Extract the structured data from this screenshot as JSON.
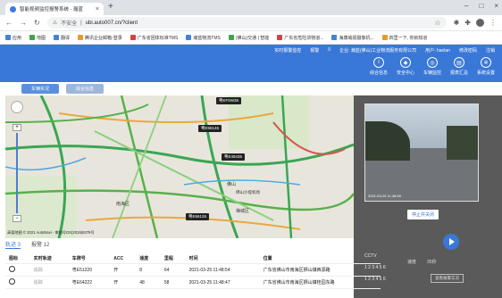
{
  "browser": {
    "tab_title": "智能视频监控报警系统 - 瀚蓝",
    "url_warning": "不安全",
    "url": "ubi.auto007.cn/?client",
    "bookmarks": [
      "应用",
      "地图",
      "翻译",
      "腾讯企业邮箱-登录",
      "广东省团体标准TMS",
      "瀚蓝物流TMS",
      "(佛山)交通 | 智能",
      "广东省危险货物道...",
      "海康威视摄像机...",
      "四里一下, 你就知道"
    ]
  },
  "header": {
    "user_items": [
      "实时报警监控",
      "报警",
      "0",
      "企业: 瀚蓝(佛山)工业物流服务有限公司",
      "用户: hanlan",
      "修改密码",
      "注销"
    ],
    "nav": [
      "综合信息",
      "安全中心",
      "车辆监控",
      "报表汇总",
      "系统设置"
    ],
    "nav_icons": [
      "info-icon",
      "shield-icon",
      "monitor-icon",
      "report-icon",
      "gear-icon"
    ]
  },
  "toolbar": {
    "realtime": "车辆实况",
    "overview": "综合信息"
  },
  "map": {
    "vehicles": [
      "粤EF5W36",
      "粤E56146",
      "粤E49435",
      "粤E66126"
    ],
    "cities": [
      "南海区",
      "佛山",
      "禅城区",
      "佛山沙堤机场"
    ],
    "attribution": "高德地图 © 2021 AutoNavi - 审图号GS(2019)6379号"
  },
  "video": {
    "timestamp": "2021-03-25 11:48:58",
    "stop_label": "停止并关闭",
    "speed_label": "速度",
    "speed_value": "35秒",
    "alarm_btn": "查看报警实况"
  },
  "panel": {
    "tabs": [
      "轨迹 3",
      "报警 12"
    ],
    "headers": [
      "图标",
      "实时轨迹",
      "车牌号",
      "ACC",
      "速度",
      "里程",
      "时间",
      "位置"
    ],
    "rows": [
      {
        "track": "追踪",
        "plate": "粤E51220",
        "acc": "开",
        "speed": "8",
        "mileage": "64",
        "time": "2021-03-25 11:48:54",
        "location": "广东省佛山市南海区狮山镇西源路"
      },
      {
        "track": "追踪",
        "plate": "粤E64222",
        "acc": "开",
        "speed": "48",
        "mileage": "58",
        "time": "2021-03-25 11:48:47",
        "location": "广东省佛山市南海区狮山镇桂园东路"
      }
    ],
    "cctv_header": "CCTV",
    "cctv_values": [
      "1 2 3 4 5 6",
      "1 2 3 4 5 6"
    ]
  }
}
